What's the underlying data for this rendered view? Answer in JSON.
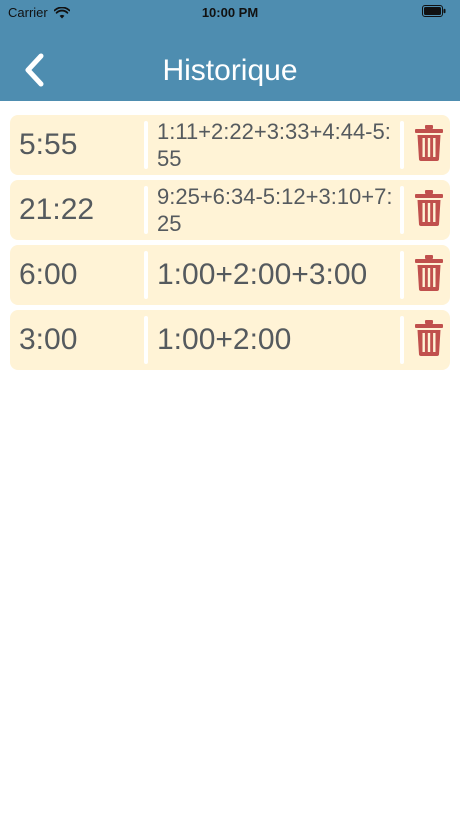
{
  "status_bar": {
    "carrier": "Carrier",
    "time": "10:00 PM"
  },
  "nav": {
    "title": "Historique",
    "back_icon": "chevron-left-icon"
  },
  "colors": {
    "header": "#4e8db0",
    "row_background": "#fff3d6",
    "text": "#555a5e",
    "delete_icon": "#c0504d"
  },
  "history": [
    {
      "total": "5:55",
      "expression": "1:11+2:22+3:33+4:44-5:55",
      "delete_icon": "trash-icon"
    },
    {
      "total": "21:22",
      "expression": "9:25+6:34-5:12+3:10+7:25",
      "delete_icon": "trash-icon"
    },
    {
      "total": "6:00",
      "expression": "1:00+2:00+3:00",
      "delete_icon": "trash-icon"
    },
    {
      "total": "3:00",
      "expression": "1:00+2:00",
      "delete_icon": "trash-icon"
    }
  ]
}
